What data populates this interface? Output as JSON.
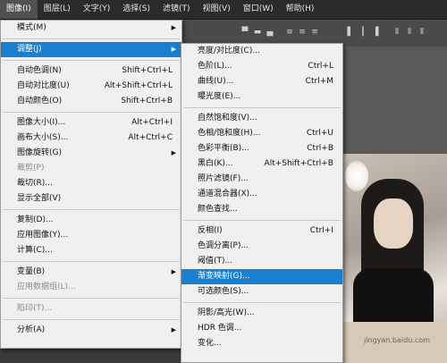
{
  "menubar": {
    "items": [
      "图像(I)",
      "图层(L)",
      "文字(Y)",
      "选择(S)",
      "滤镜(T)",
      "视图(V)",
      "窗口(W)",
      "帮助(H)"
    ]
  },
  "image_menu": {
    "items": [
      {
        "label": "模式(M)",
        "shortcut": "",
        "submenu": true,
        "disabled": false
      },
      {
        "label": "调整(J)",
        "shortcut": "",
        "submenu": true,
        "disabled": false,
        "highlighted": true
      },
      {
        "label": "自动色调(N)",
        "shortcut": "Shift+Ctrl+L",
        "submenu": false,
        "disabled": false
      },
      {
        "label": "自动对比度(U)",
        "shortcut": "Alt+Shift+Ctrl+L",
        "submenu": false,
        "disabled": false
      },
      {
        "label": "自动颜色(O)",
        "shortcut": "Shift+Ctrl+B",
        "submenu": false,
        "disabled": false
      },
      {
        "label": "图像大小(I)...",
        "shortcut": "Alt+Ctrl+I",
        "submenu": false,
        "disabled": false
      },
      {
        "label": "画布大小(S)...",
        "shortcut": "Alt+Ctrl+C",
        "submenu": false,
        "disabled": false
      },
      {
        "label": "图像旋转(G)",
        "shortcut": "",
        "submenu": true,
        "disabled": false
      },
      {
        "label": "裁剪(P)",
        "shortcut": "",
        "submenu": false,
        "disabled": true
      },
      {
        "label": "裁切(R)...",
        "shortcut": "",
        "submenu": false,
        "disabled": false
      },
      {
        "label": "显示全部(V)",
        "shortcut": "",
        "submenu": false,
        "disabled": false
      },
      {
        "label": "复制(D)...",
        "shortcut": "",
        "submenu": false,
        "disabled": false
      },
      {
        "label": "应用图像(Y)...",
        "shortcut": "",
        "submenu": false,
        "disabled": false
      },
      {
        "label": "计算(C)...",
        "shortcut": "",
        "submenu": false,
        "disabled": false
      },
      {
        "label": "变量(B)",
        "shortcut": "",
        "submenu": true,
        "disabled": false
      },
      {
        "label": "应用数据组(L)...",
        "shortcut": "",
        "submenu": false,
        "disabled": true
      },
      {
        "label": "陷印(T)...",
        "shortcut": "",
        "submenu": false,
        "disabled": true
      },
      {
        "label": "分析(A)",
        "shortcut": "",
        "submenu": true,
        "disabled": false
      }
    ]
  },
  "adjust_menu": {
    "items": [
      {
        "label": "亮度/对比度(C)...",
        "shortcut": ""
      },
      {
        "label": "色阶(L)...",
        "shortcut": "Ctrl+L"
      },
      {
        "label": "曲线(U)...",
        "shortcut": "Ctrl+M"
      },
      {
        "label": "曝光度(E)...",
        "shortcut": ""
      },
      {
        "label": "自然饱和度(V)...",
        "shortcut": ""
      },
      {
        "label": "色相/饱和度(H)...",
        "shortcut": "Ctrl+U"
      },
      {
        "label": "色彩平衡(B)...",
        "shortcut": "Ctrl+B"
      },
      {
        "label": "黑白(K)...",
        "shortcut": "Alt+Shift+Ctrl+B"
      },
      {
        "label": "照片滤镜(F)...",
        "shortcut": ""
      },
      {
        "label": "通道混合器(X)...",
        "shortcut": ""
      },
      {
        "label": "颜色查找...",
        "shortcut": ""
      },
      {
        "label": "反相(I)",
        "shortcut": "Ctrl+I"
      },
      {
        "label": "色调分离(P)...",
        "shortcut": ""
      },
      {
        "label": "阈值(T)...",
        "shortcut": ""
      },
      {
        "label": "渐变映射(G)...",
        "shortcut": "",
        "highlighted": true
      },
      {
        "label": "可选颜色(S)...",
        "shortcut": ""
      },
      {
        "label": "阴影/高光(W)...",
        "shortcut": ""
      },
      {
        "label": "HDR 色调...",
        "shortcut": ""
      },
      {
        "label": "变化...",
        "shortcut": ""
      }
    ]
  },
  "watermark": "jingyan.baidu.com",
  "colors": {
    "highlight": "#1b7fcf",
    "menu_bg": "#f0f0f0",
    "menubar_bg": "#2b2b2b"
  }
}
